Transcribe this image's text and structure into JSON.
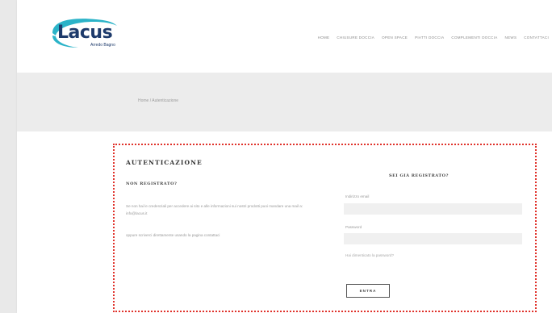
{
  "brand": {
    "name": "Lacus",
    "tagline": "Arredo Bagno",
    "accent_color": "#2bb3c8",
    "text_color": "#1d3a6b"
  },
  "nav": {
    "items": [
      "HOME",
      "CHIUSURE DOCCIA",
      "OPEN SPACE",
      "PIATTI DOCCIA",
      "COMPLEMENTI DOCCIA",
      "NEWS",
      "CONTATTACI"
    ]
  },
  "banner": {
    "breadcrumb": "Home / Autenticazione"
  },
  "auth": {
    "title": "AUTENTICAZIONE",
    "left": {
      "heading": "NON REGISTRATO?",
      "paragraph1": "Se non hai le credenziali per accedere ai sito e alle informazioni sui nostri prodotti puoi mandare una mail a: info@lacus.it",
      "paragraph2": "oppure scriverci direttamente usando la pagina contattaci"
    },
    "right": {
      "heading": "SEI GIÀ REGISTRATO?",
      "email_label": "Indirizzo email",
      "email_value": "",
      "password_label": "Password",
      "password_value": "",
      "forgot_link": "Hai dimenticato la password?",
      "submit_label": "ENTRA"
    },
    "highlight_color": "#e0322b"
  }
}
